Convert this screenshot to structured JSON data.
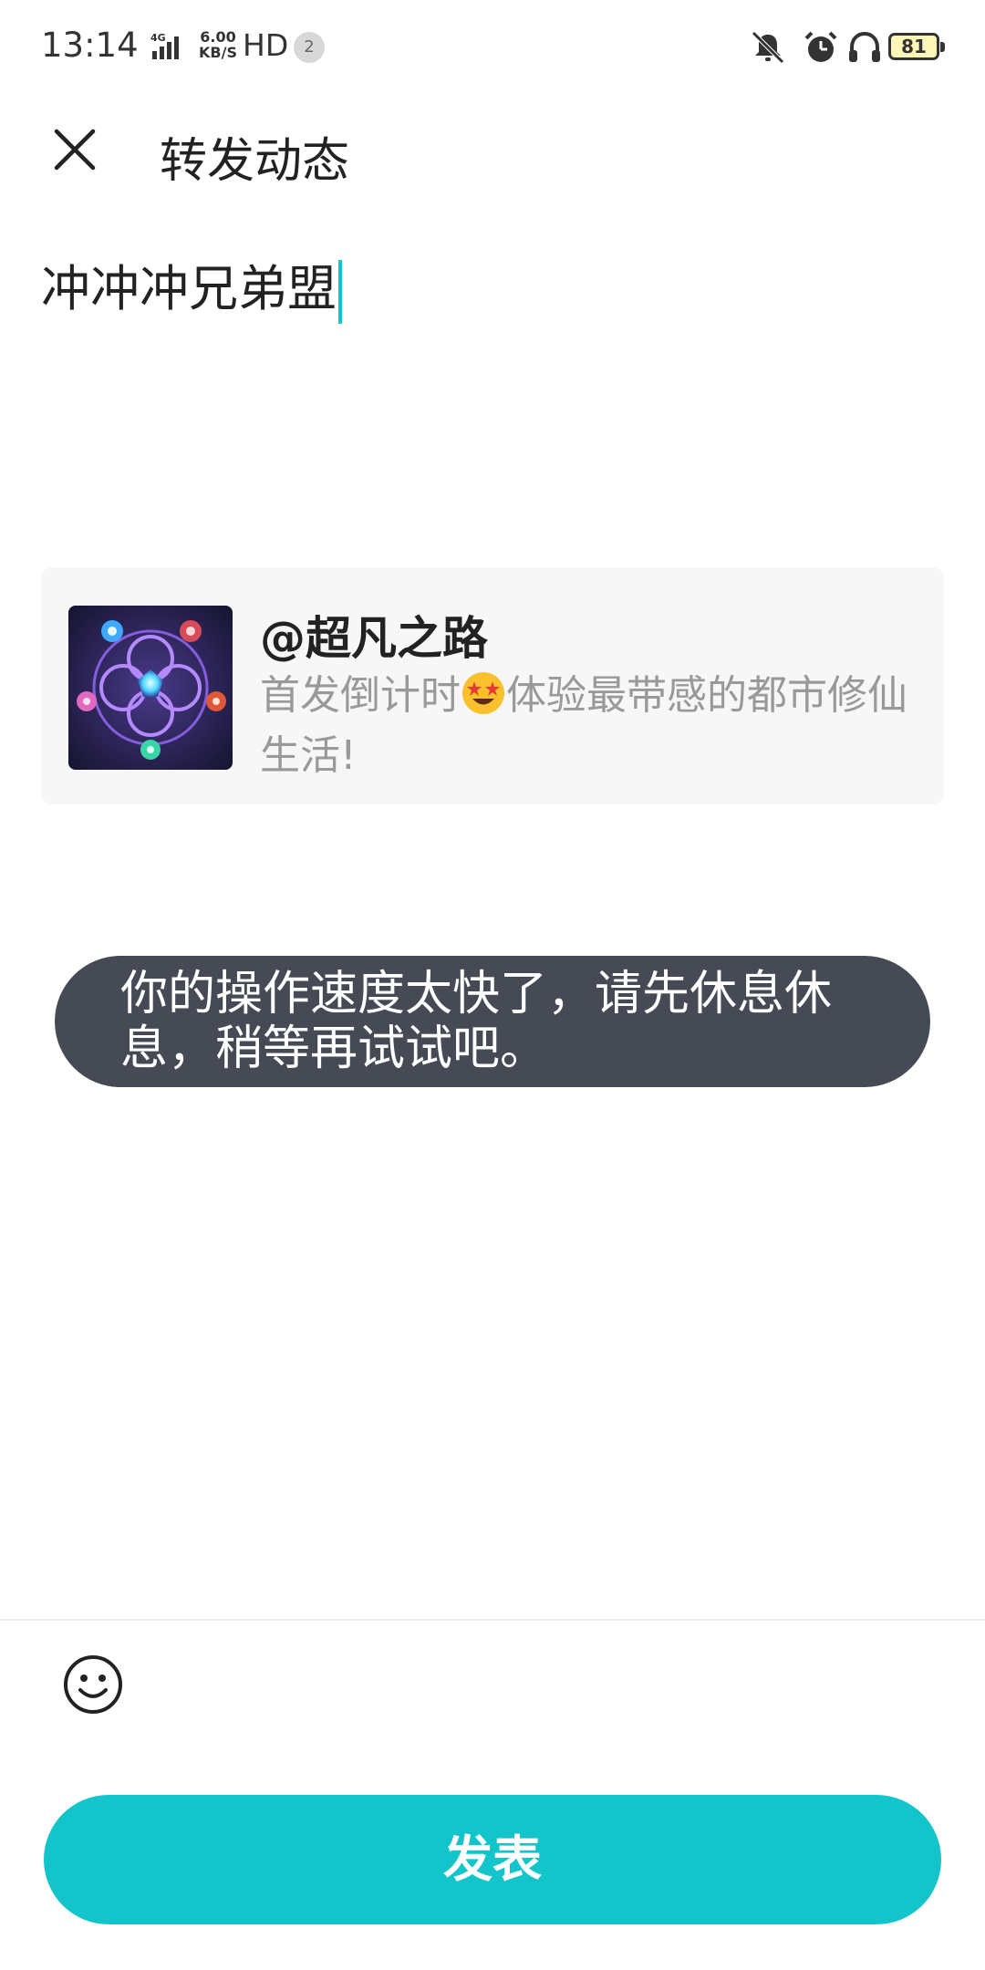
{
  "status_bar": {
    "time": "13:14",
    "network": "4G",
    "speed_value": "6.00",
    "speed_unit": "KB/S",
    "hd": "HD",
    "notification_count": "2",
    "battery": "81",
    "icons": [
      "signal-icon",
      "mute-icon",
      "alarm-icon",
      "headphones-icon",
      "battery-icon"
    ]
  },
  "header": {
    "close_icon": "close-icon",
    "title": "转发动态"
  },
  "compose": {
    "text": "冲冲冲兄弟盟"
  },
  "shared_card": {
    "author": "@超凡之路",
    "desc_before_emoji": "首发倒计时",
    "emoji": "star-struck-emoji",
    "desc_after_emoji": "体验最带感的都市修仙生活!"
  },
  "toast": {
    "message": "你的操作速度太快了，请先休息休息，稍等再试试吧。"
  },
  "footer": {
    "emoji_button_icon": "smiley-icon",
    "publish_label": "发表"
  },
  "colors": {
    "accent": "#13c4cb",
    "toast_bg": "#454a55",
    "card_bg": "#f7f7f7",
    "muted_text": "#999999"
  }
}
